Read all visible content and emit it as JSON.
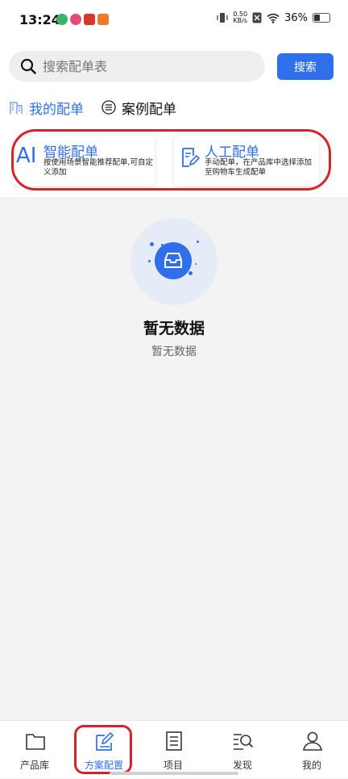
{
  "status": {
    "time": "13:24",
    "battery": "36%",
    "speed_value": "0.50",
    "speed_unit": "KB/s"
  },
  "search": {
    "placeholder": "搜索配单表",
    "button": "搜索"
  },
  "tabs": [
    {
      "label": "我的配单",
      "active": true
    },
    {
      "label": "案例配单",
      "active": false
    }
  ],
  "cards": [
    {
      "icon_text": "AI",
      "title": "智能配单",
      "desc": "按使用场景智能推荐配单,可自定义添加"
    },
    {
      "title": "人工配单",
      "desc": "手动配单，在产品库中选择添加至购物车生成配单"
    }
  ],
  "empty": {
    "title": "暂无数据",
    "subtitle": "暂无数据"
  },
  "bottom_nav": [
    {
      "label": "产品库",
      "icon": "folder-icon"
    },
    {
      "label": "方案配置",
      "icon": "edit-doc-icon",
      "active": true
    },
    {
      "label": "项目",
      "icon": "list-doc-icon"
    },
    {
      "label": "发现",
      "icon": "discover-search-icon"
    },
    {
      "label": "我的",
      "icon": "user-icon"
    }
  ],
  "colors": {
    "accent": "#2f6fe9",
    "highlight": "#d2242a"
  }
}
